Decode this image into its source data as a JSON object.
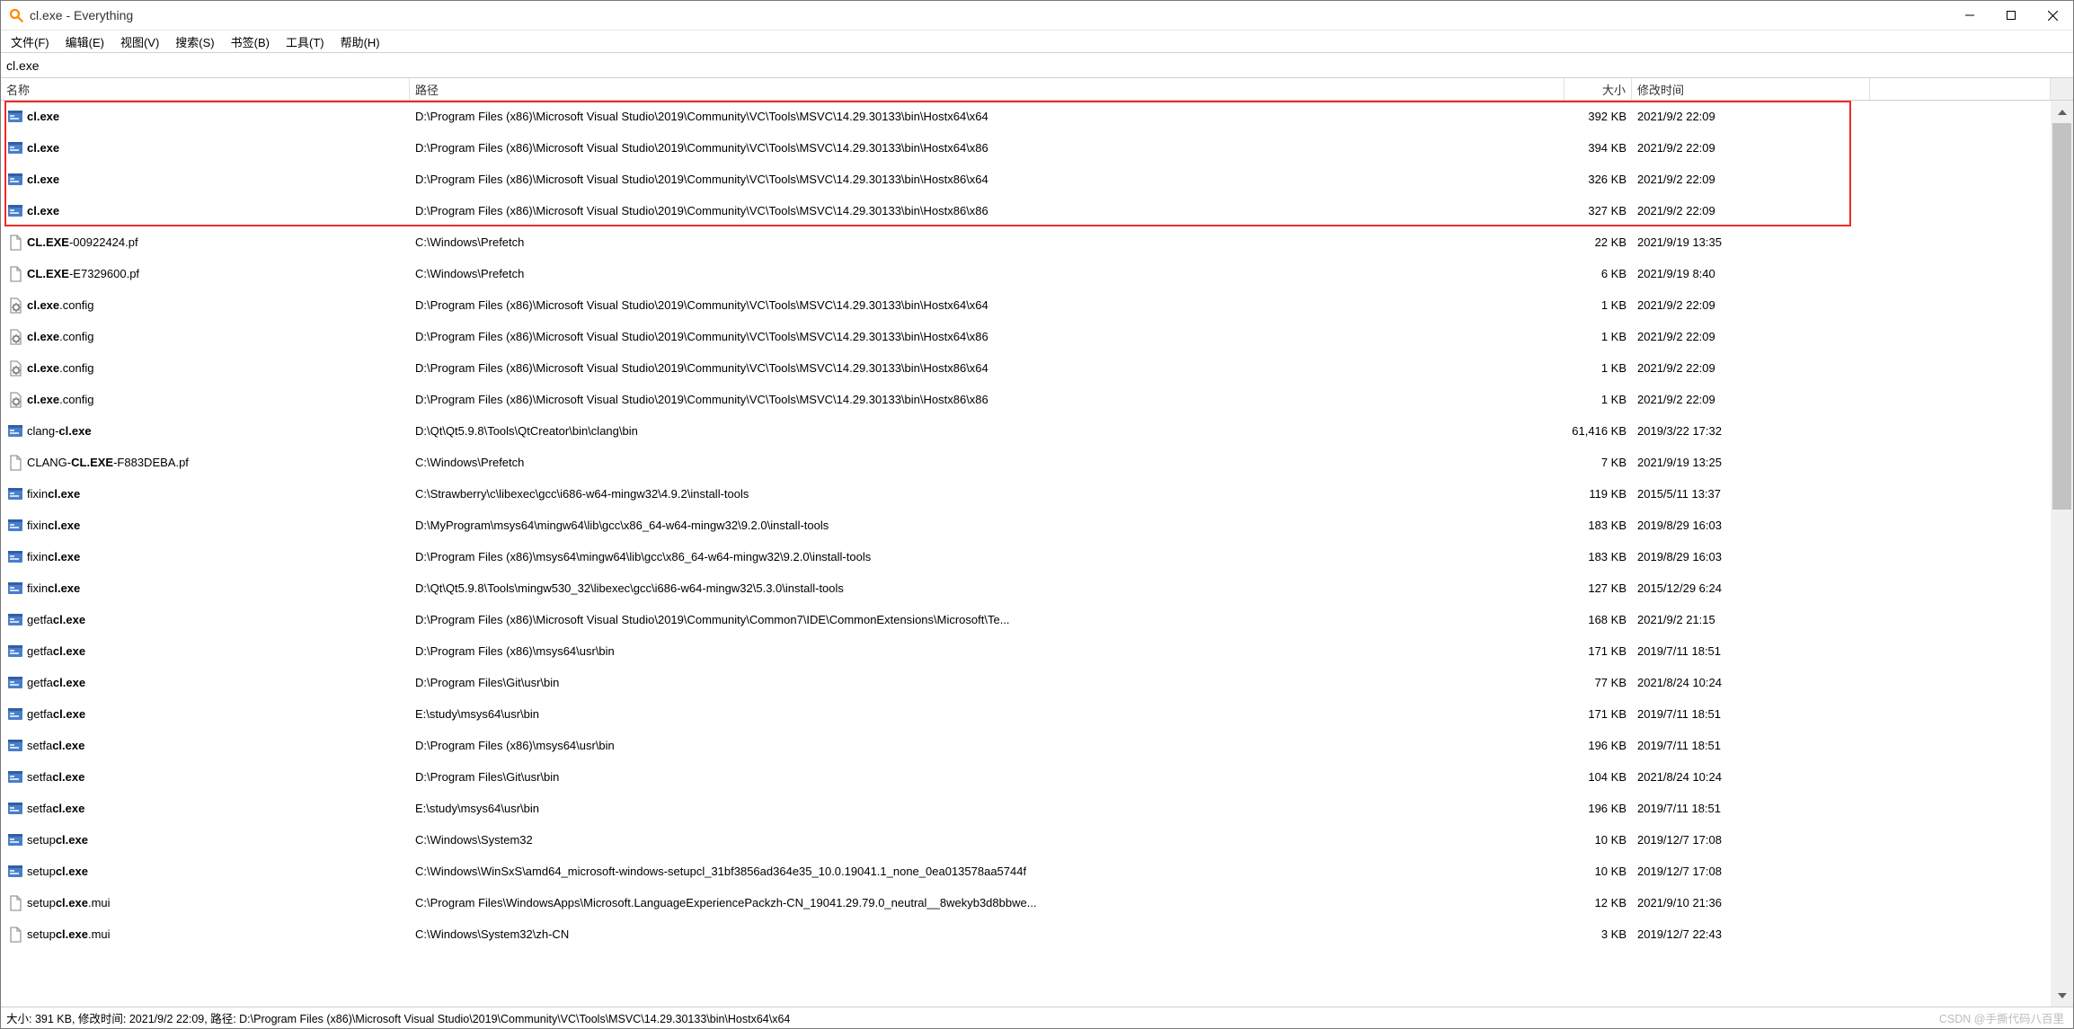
{
  "window": {
    "title": "cl.exe - Everything"
  },
  "win_controls": {
    "min": "minimize",
    "max": "maximize",
    "close": "close"
  },
  "menu": [
    {
      "label": "文件(F)"
    },
    {
      "label": "编辑(E)"
    },
    {
      "label": "视图(V)"
    },
    {
      "label": "搜索(S)"
    },
    {
      "label": "书签(B)"
    },
    {
      "label": "工具(T)"
    },
    {
      "label": "帮助(H)"
    }
  ],
  "search": {
    "value": "cl.exe"
  },
  "columns": {
    "name": "名称",
    "path": "路径",
    "size": "大小",
    "date": "修改时间"
  },
  "query": "cl.exe",
  "rows": [
    {
      "icon": "exe",
      "name": "cl.exe",
      "path": "D:\\Program Files (x86)\\Microsoft Visual Studio\\2019\\Community\\VC\\Tools\\MSVC\\14.29.30133\\bin\\Hostx64\\x64",
      "size": "392 KB",
      "date": "2021/9/2 22:09"
    },
    {
      "icon": "exe",
      "name": "cl.exe",
      "path": "D:\\Program Files (x86)\\Microsoft Visual Studio\\2019\\Community\\VC\\Tools\\MSVC\\14.29.30133\\bin\\Hostx64\\x86",
      "size": "394 KB",
      "date": "2021/9/2 22:09"
    },
    {
      "icon": "exe",
      "name": "cl.exe",
      "path": "D:\\Program Files (x86)\\Microsoft Visual Studio\\2019\\Community\\VC\\Tools\\MSVC\\14.29.30133\\bin\\Hostx86\\x64",
      "size": "326 KB",
      "date": "2021/9/2 22:09"
    },
    {
      "icon": "exe",
      "name": "cl.exe",
      "path": "D:\\Program Files (x86)\\Microsoft Visual Studio\\2019\\Community\\VC\\Tools\\MSVC\\14.29.30133\\bin\\Hostx86\\x86",
      "size": "327 KB",
      "date": "2021/9/2 22:09"
    },
    {
      "icon": "file",
      "name": "CL.EXE-00922424.pf",
      "path": "C:\\Windows\\Prefetch",
      "size": "22 KB",
      "date": "2021/9/19 13:35"
    },
    {
      "icon": "file",
      "name": "CL.EXE-E7329600.pf",
      "path": "C:\\Windows\\Prefetch",
      "size": "6 KB",
      "date": "2021/9/19 8:40"
    },
    {
      "icon": "cfg",
      "name": "cl.exe.config",
      "path": "D:\\Program Files (x86)\\Microsoft Visual Studio\\2019\\Community\\VC\\Tools\\MSVC\\14.29.30133\\bin\\Hostx64\\x64",
      "size": "1 KB",
      "date": "2021/9/2 22:09"
    },
    {
      "icon": "cfg",
      "name": "cl.exe.config",
      "path": "D:\\Program Files (x86)\\Microsoft Visual Studio\\2019\\Community\\VC\\Tools\\MSVC\\14.29.30133\\bin\\Hostx64\\x86",
      "size": "1 KB",
      "date": "2021/9/2 22:09"
    },
    {
      "icon": "cfg",
      "name": "cl.exe.config",
      "path": "D:\\Program Files (x86)\\Microsoft Visual Studio\\2019\\Community\\VC\\Tools\\MSVC\\14.29.30133\\bin\\Hostx86\\x64",
      "size": "1 KB",
      "date": "2021/9/2 22:09"
    },
    {
      "icon": "cfg",
      "name": "cl.exe.config",
      "path": "D:\\Program Files (x86)\\Microsoft Visual Studio\\2019\\Community\\VC\\Tools\\MSVC\\14.29.30133\\bin\\Hostx86\\x86",
      "size": "1 KB",
      "date": "2021/9/2 22:09"
    },
    {
      "icon": "exe",
      "name": "clang-cl.exe",
      "path": "D:\\Qt\\Qt5.9.8\\Tools\\QtCreator\\bin\\clang\\bin",
      "size": "61,416 KB",
      "date": "2019/3/22 17:32"
    },
    {
      "icon": "file",
      "name": "CLANG-CL.EXE-F883DEBA.pf",
      "path": "C:\\Windows\\Prefetch",
      "size": "7 KB",
      "date": "2021/9/19 13:25"
    },
    {
      "icon": "exe",
      "name": "fixincl.exe",
      "path": "C:\\Strawberry\\c\\libexec\\gcc\\i686-w64-mingw32\\4.9.2\\install-tools",
      "size": "119 KB",
      "date": "2015/5/11 13:37"
    },
    {
      "icon": "exe",
      "name": "fixincl.exe",
      "path": "D:\\MyProgram\\msys64\\mingw64\\lib\\gcc\\x86_64-w64-mingw32\\9.2.0\\install-tools",
      "size": "183 KB",
      "date": "2019/8/29 16:03"
    },
    {
      "icon": "exe",
      "name": "fixincl.exe",
      "path": "D:\\Program Files (x86)\\msys64\\mingw64\\lib\\gcc\\x86_64-w64-mingw32\\9.2.0\\install-tools",
      "size": "183 KB",
      "date": "2019/8/29 16:03"
    },
    {
      "icon": "exe",
      "name": "fixincl.exe",
      "path": "D:\\Qt\\Qt5.9.8\\Tools\\mingw530_32\\libexec\\gcc\\i686-w64-mingw32\\5.3.0\\install-tools",
      "size": "127 KB",
      "date": "2015/12/29 6:24"
    },
    {
      "icon": "exe",
      "name": "getfacl.exe",
      "path": "D:\\Program Files (x86)\\Microsoft Visual Studio\\2019\\Community\\Common7\\IDE\\CommonExtensions\\Microsoft\\Te...",
      "size": "168 KB",
      "date": "2021/9/2 21:15"
    },
    {
      "icon": "exe",
      "name": "getfacl.exe",
      "path": "D:\\Program Files (x86)\\msys64\\usr\\bin",
      "size": "171 KB",
      "date": "2019/7/11 18:51"
    },
    {
      "icon": "exe",
      "name": "getfacl.exe",
      "path": "D:\\Program Files\\Git\\usr\\bin",
      "size": "77 KB",
      "date": "2021/8/24 10:24"
    },
    {
      "icon": "exe",
      "name": "getfacl.exe",
      "path": "E:\\study\\msys64\\usr\\bin",
      "size": "171 KB",
      "date": "2019/7/11 18:51"
    },
    {
      "icon": "exe",
      "name": "setfacl.exe",
      "path": "D:\\Program Files (x86)\\msys64\\usr\\bin",
      "size": "196 KB",
      "date": "2019/7/11 18:51"
    },
    {
      "icon": "exe",
      "name": "setfacl.exe",
      "path": "D:\\Program Files\\Git\\usr\\bin",
      "size": "104 KB",
      "date": "2021/8/24 10:24"
    },
    {
      "icon": "exe",
      "name": "setfacl.exe",
      "path": "E:\\study\\msys64\\usr\\bin",
      "size": "196 KB",
      "date": "2019/7/11 18:51"
    },
    {
      "icon": "exe",
      "name": "setupcl.exe",
      "path": "C:\\Windows\\System32",
      "size": "10 KB",
      "date": "2019/12/7 17:08"
    },
    {
      "icon": "exe",
      "name": "setupcl.exe",
      "path": "C:\\Windows\\WinSxS\\amd64_microsoft-windows-setupcl_31bf3856ad364e35_10.0.19041.1_none_0ea013578aa5744f",
      "size": "10 KB",
      "date": "2019/12/7 17:08"
    },
    {
      "icon": "file",
      "name": "setupcl.exe.mui",
      "path": "C:\\Program Files\\WindowsApps\\Microsoft.LanguageExperiencePackzh-CN_19041.29.79.0_neutral__8wekyb3d8bbwe...",
      "size": "12 KB",
      "date": "2021/9/10 21:36"
    },
    {
      "icon": "file",
      "name": "setupcl.exe.mui",
      "path": "C:\\Windows\\System32\\zh-CN",
      "size": "3 KB",
      "date": "2019/12/7 22:43"
    }
  ],
  "status": {
    "text": "大小: 391 KB, 修改时间: 2021/9/2 22:09, 路径: D:\\Program Files (x86)\\Microsoft Visual Studio\\2019\\Community\\VC\\Tools\\MSVC\\14.29.30133\\bin\\Hostx64\\x64"
  },
  "watermark": "CSDN @手撕代码八百里"
}
